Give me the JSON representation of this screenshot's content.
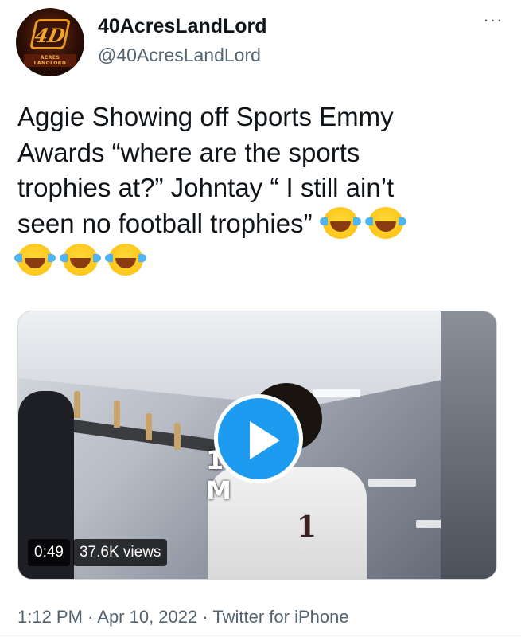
{
  "tweet": {
    "author": {
      "display_name": "40AcresLandLord",
      "handle": "@40AcresLandLord",
      "avatar_mark": "4D",
      "avatar_caption": "ACRES LANDLORD"
    },
    "more_label": "···",
    "text_line1": "Aggie Showing off Sports Emmy",
    "text_line2": "Awards  “where are the sports",
    "text_line3": "trophies at?” Johntay “ I still ain’t",
    "text_line4": "seen no football trophies”",
    "emoji_name": "face-with-tears-of-joy-icon",
    "emoji_count": 5,
    "video": {
      "overlay_text": "1 M",
      "jersey_text": "1",
      "duration": "0:49",
      "views": "37.6K views"
    },
    "timestamp": "1:12 PM · Apr 10, 2022 · ",
    "source": "Twitter for iPhone"
  },
  "colors": {
    "accent": "#1d9bf0",
    "text_primary": "#0f1419",
    "text_secondary": "#536471"
  }
}
